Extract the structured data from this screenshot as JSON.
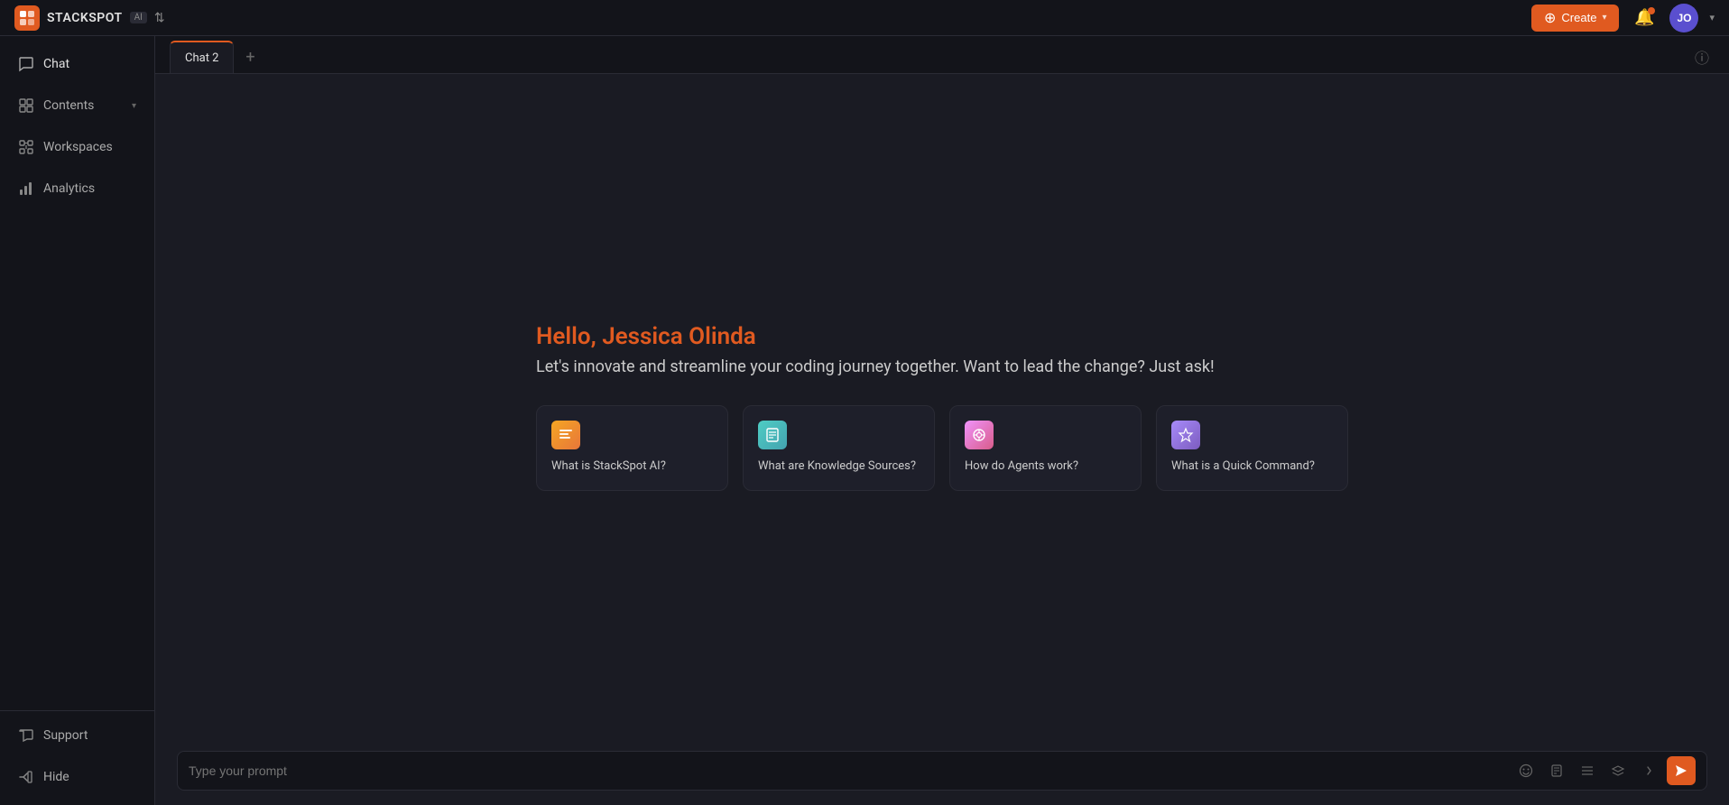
{
  "topbar": {
    "logo_text": "STACKSPOT",
    "logo_badge": "AI",
    "create_label": "Create",
    "avatar_initials": "JO"
  },
  "sidebar": {
    "items": [
      {
        "id": "chat",
        "label": "Chat",
        "icon": "💬",
        "active": true
      },
      {
        "id": "contents",
        "label": "Contents",
        "icon": "⊞",
        "has_chevron": true
      },
      {
        "id": "workspaces",
        "label": "Workspaces",
        "icon": "▦"
      },
      {
        "id": "analytics",
        "label": "Analytics",
        "icon": "📊"
      }
    ],
    "bottom_items": [
      {
        "id": "support",
        "label": "Support",
        "icon": "🗨"
      },
      {
        "id": "hide",
        "label": "Hide",
        "icon": "⟵"
      }
    ]
  },
  "tabs": [
    {
      "id": "chat2",
      "label": "Chat 2",
      "active": true
    }
  ],
  "welcome": {
    "greeting": "Hello, Jessica Olinda",
    "subtitle": "Let's innovate and streamline your coding journey together. Want to lead the change? Just ask!"
  },
  "cards": [
    {
      "id": "stackspot",
      "label": "What is StackSpot AI?",
      "icon_type": "orange",
      "icon": "📋"
    },
    {
      "id": "knowledge",
      "label": "What are Knowledge Sources?",
      "icon_type": "teal",
      "icon": "📄"
    },
    {
      "id": "agents",
      "label": "How do Agents work?",
      "icon_type": "pink",
      "icon": "🔄"
    },
    {
      "id": "quickcmd",
      "label": "What is a Quick Command?",
      "icon_type": "purple",
      "icon": "⚡"
    }
  ],
  "input": {
    "placeholder": "Type your prompt"
  }
}
